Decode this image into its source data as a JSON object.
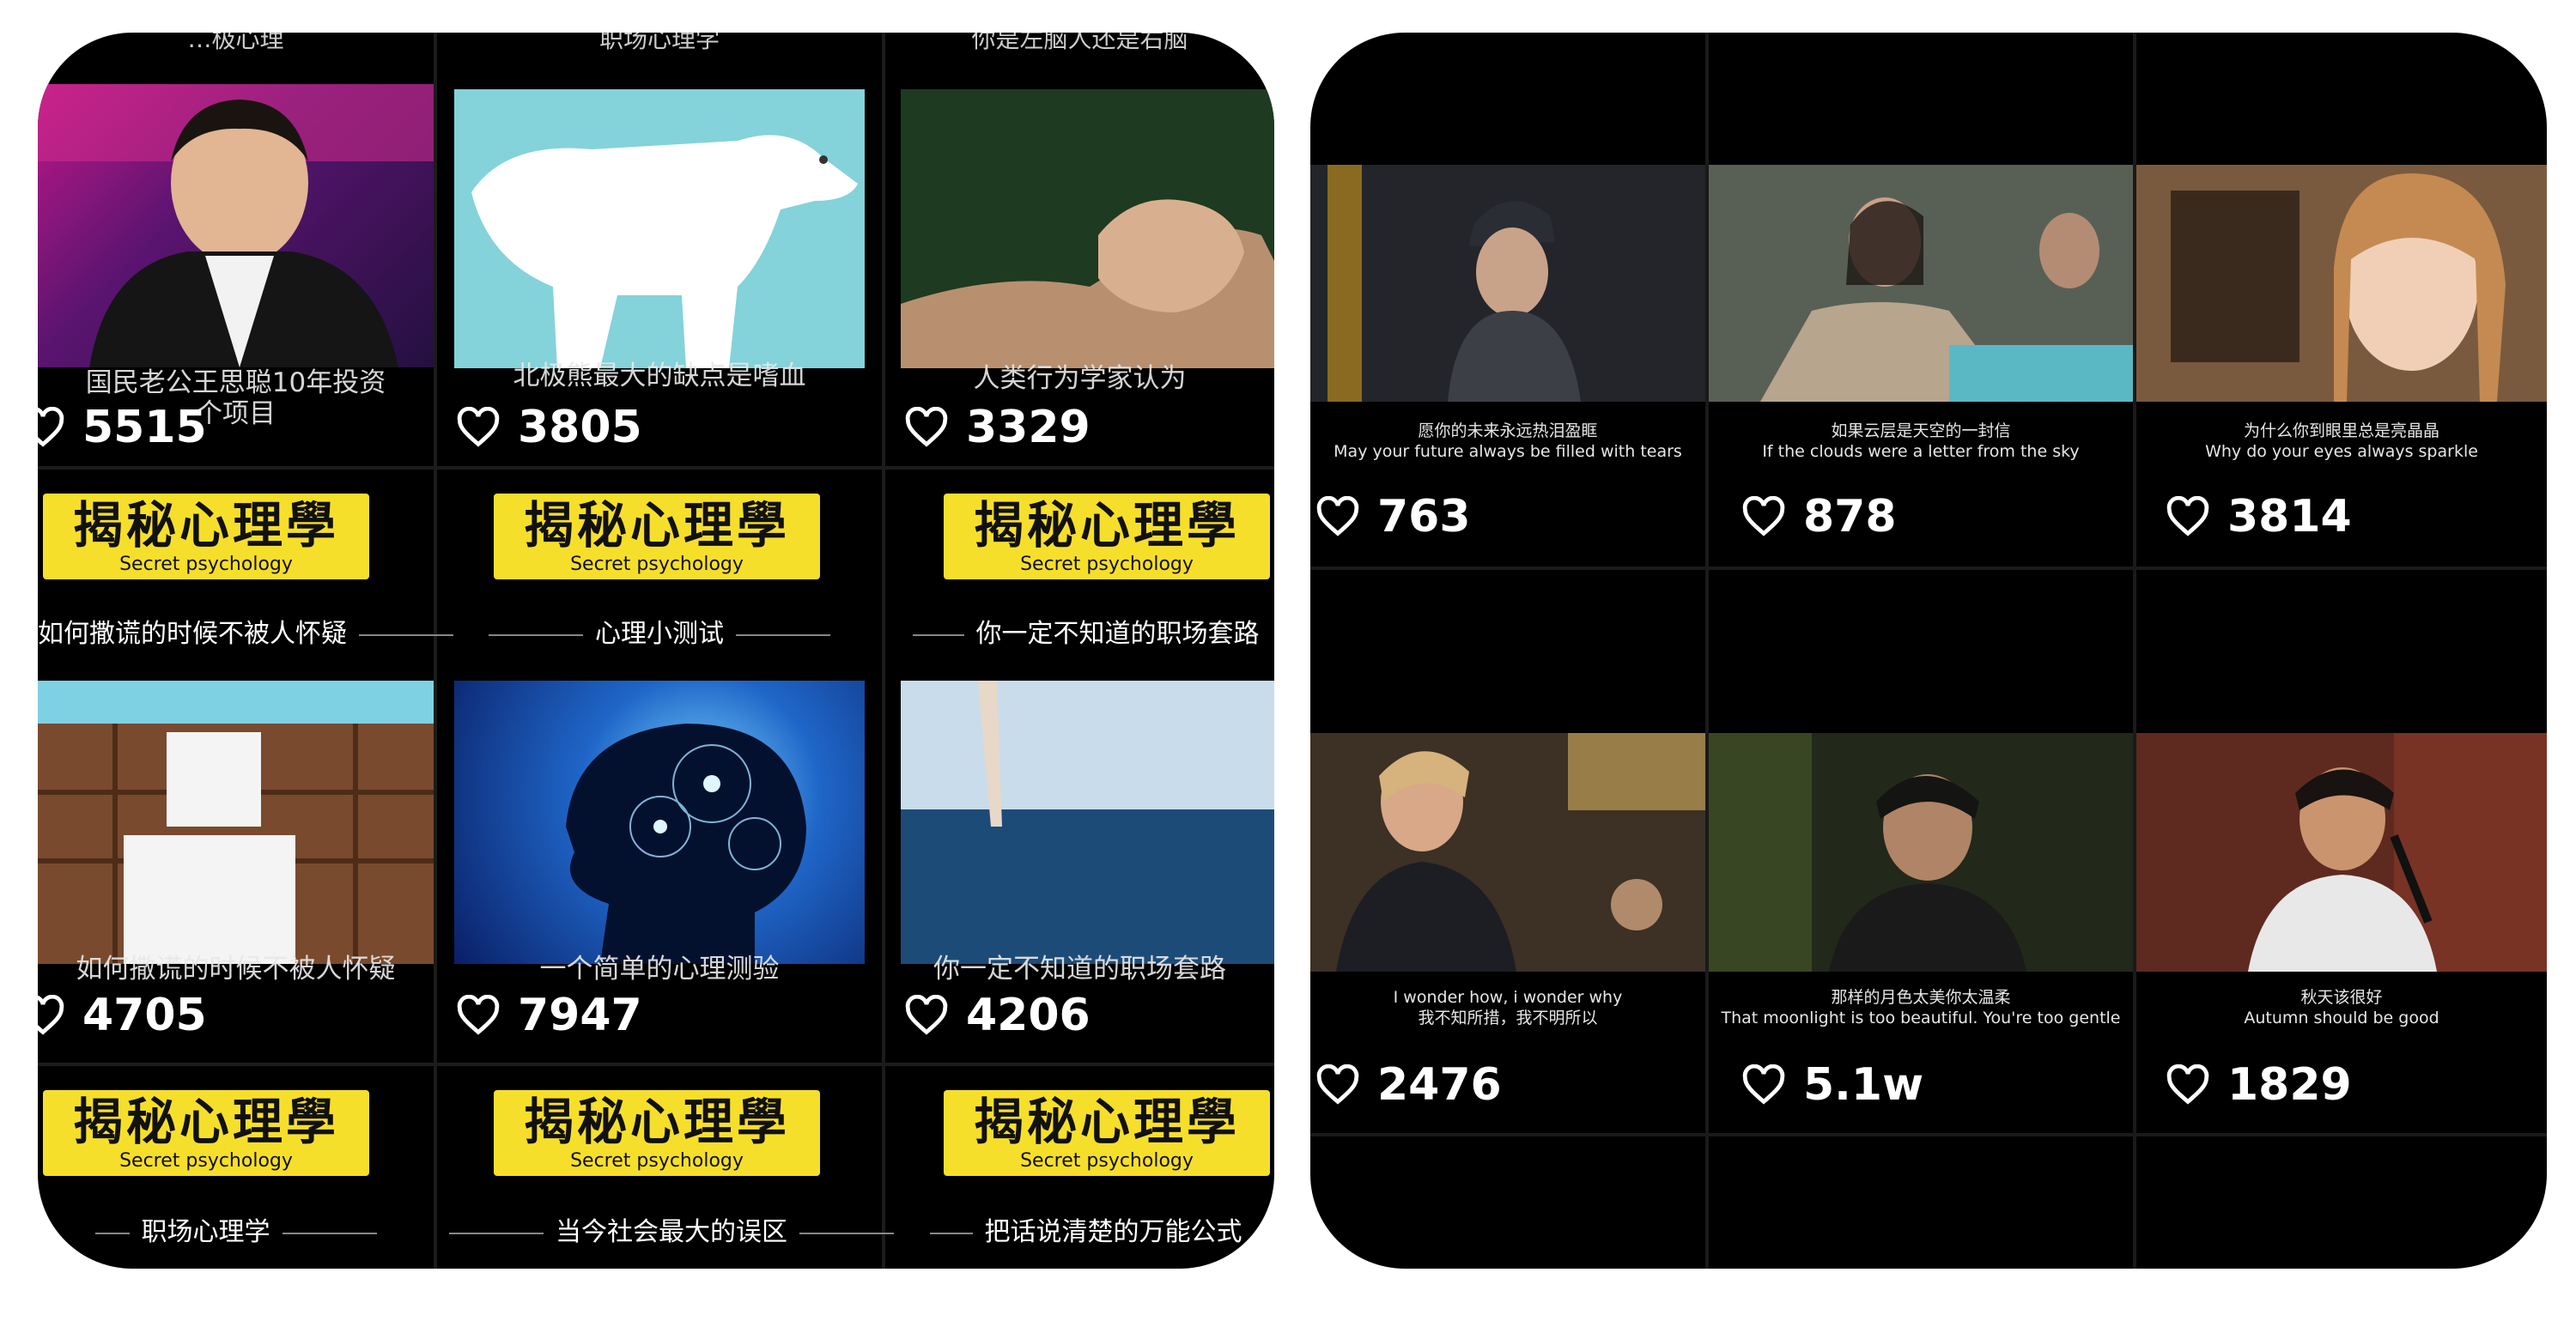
{
  "left_panel": {
    "top_partial_texts": [
      "…极心理",
      "职场心理学",
      "你是左脑人还是右脑"
    ],
    "row1": [
      {
        "caption": "国民老公王思聪10年投资\n个项目",
        "likes": "5515",
        "thumb_icon": "man-portrait-thumbnail"
      },
      {
        "caption": "北极熊最大的缺点是嗜血",
        "likes": "3805",
        "thumb_icon": "polar-bear-thumbnail"
      },
      {
        "caption": "人类行为学家认为",
        "likes": "3329",
        "thumb_icon": "clasped-hands-thumbnail"
      }
    ],
    "banner_title": "揭秘心理學",
    "banner_sub": "Secret psychology",
    "row2_subtitles": [
      "如何撒谎的时候不被人怀疑",
      "心理小测试",
      "你一定不知道的职场套路"
    ],
    "row3": [
      {
        "caption": "如何撒谎的时候不被人怀疑",
        "likes": "4705",
        "thumb_icon": "wood-figure-thumbnail"
      },
      {
        "caption": "一个简单的心理测验",
        "likes": "7947",
        "thumb_icon": "brain-head-thumbnail"
      },
      {
        "caption": "你一定不知道的职场套路",
        "likes": "4206",
        "thumb_icon": "office-legs-thumbnail"
      }
    ],
    "row4_subtitles": [
      "职场心理学",
      "当今社会最大的误区",
      "把话说清楚的万能公式"
    ]
  },
  "right_panel": {
    "row1": [
      {
        "zh": "愿你的未来永远热泪盈眶",
        "en": "May your future always be filled with tears",
        "likes": "763"
      },
      {
        "zh": "如果云层是天空的一封信",
        "en": "If the clouds were a letter from the sky",
        "likes": "878"
      },
      {
        "zh": "为什么你到眼里总是亮晶晶",
        "en": "Why do your eyes always sparkle",
        "likes": "3814"
      }
    ],
    "row2": [
      {
        "zh": "我不知所措，我不明所以",
        "en": "I wonder how, i wonder why",
        "likes": "2476"
      },
      {
        "zh": "那样的月色太美你太温柔",
        "en": "That moonlight is too beautiful. You're too gentle",
        "likes": "5.1w"
      },
      {
        "zh": "秋天该很好",
        "en": "Autumn should be good",
        "likes": "1829"
      }
    ]
  },
  "colors": {
    "banner": "#f6df2b",
    "background": "#000000",
    "divider": "#1c1c1c"
  }
}
